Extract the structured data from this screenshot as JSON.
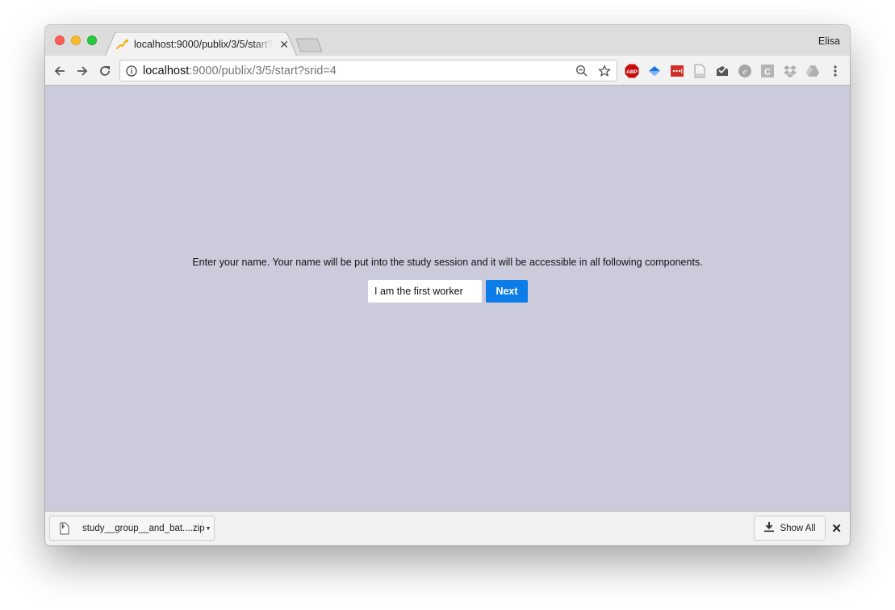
{
  "browser": {
    "profile_name": "Elisa",
    "tab": {
      "title": "localhost:9000/publix/3/5/start?srid=4",
      "favicon": "jatos-runner-icon"
    },
    "address_bar": {
      "host": "localhost",
      "path": ":9000/publix/3/5/start?srid=4"
    },
    "extensions": [
      {
        "name": "adblock-plus-icon",
        "label": "ABP",
        "color": "#c70d0d"
      },
      {
        "name": "blue-diamond-extension-icon",
        "color": "#1a73e8"
      },
      {
        "name": "lastpass-icon",
        "color": "#d32d27"
      },
      {
        "name": "document-extension-icon",
        "color": "#9a9a9a"
      },
      {
        "name": "mail-checker-icon",
        "color": "#555555"
      },
      {
        "name": "evernote-e-icon",
        "color": "#9a9a9a"
      },
      {
        "name": "c-extension-icon",
        "label": "C",
        "color": "#b5b5b5"
      },
      {
        "name": "dropbox-icon",
        "color": "#b0b0b0"
      },
      {
        "name": "google-drive-icon",
        "color": "#b0b0b0"
      }
    ]
  },
  "page": {
    "prompt": "Enter your name. Your name will be put into the study session and it will be accessible in all following components.",
    "name_input_value": "I am the first worker",
    "next_label": "Next",
    "background_color": "#cccbdb",
    "accent_color": "#0b7ce8"
  },
  "download_shelf": {
    "file_name": "study__group__and_bat....zip",
    "show_all_label": "Show All"
  }
}
